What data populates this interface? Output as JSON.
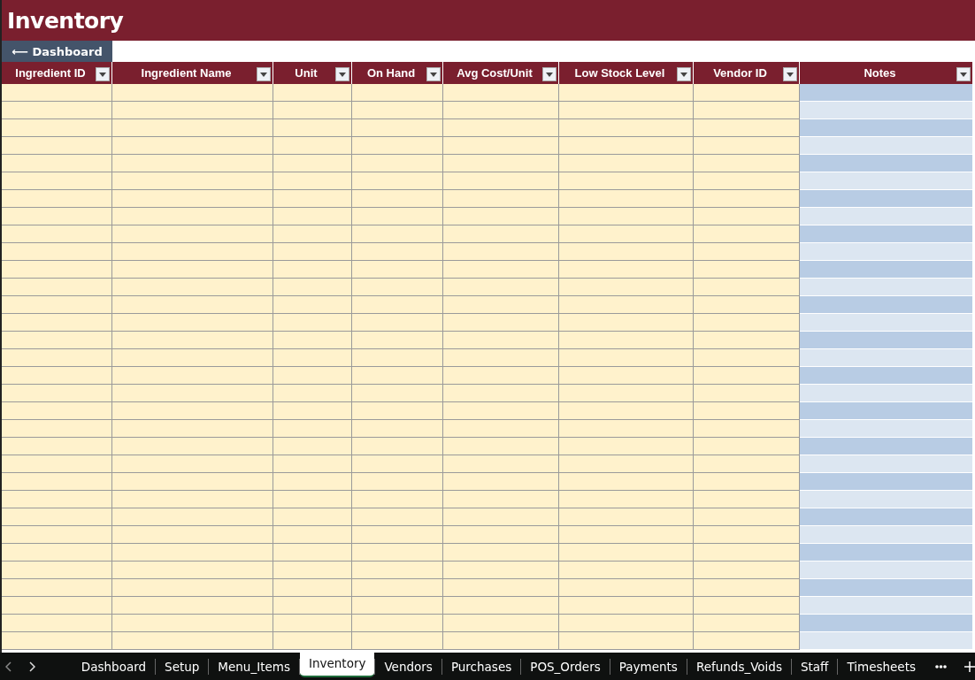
{
  "title": "Inventory",
  "back_button": {
    "label": "⟵ Dashboard"
  },
  "table": {
    "columns": [
      {
        "label": "Ingredient ID",
        "kind": "data"
      },
      {
        "label": "Ingredient Name",
        "kind": "data"
      },
      {
        "label": "Unit",
        "kind": "data"
      },
      {
        "label": "On Hand",
        "kind": "data"
      },
      {
        "label": "Avg Cost/Unit",
        "kind": "data"
      },
      {
        "label": "Low Stock Level",
        "kind": "data"
      },
      {
        "label": "Vendor ID",
        "kind": "data"
      },
      {
        "label": "Notes",
        "kind": "banded"
      }
    ]
  },
  "sheet_tabs": [
    {
      "label": "Dashboard",
      "selected": false
    },
    {
      "label": "Setup",
      "selected": false
    },
    {
      "label": "Menu_Items",
      "selected": false
    },
    {
      "label": "Inventory",
      "selected": true
    },
    {
      "label": "Vendors",
      "selected": false
    },
    {
      "label": "Purchases",
      "selected": false
    },
    {
      "label": "POS_Orders",
      "selected": false
    },
    {
      "label": "Payments",
      "selected": false
    },
    {
      "label": "Refunds_Voids",
      "selected": false
    },
    {
      "label": "Staff",
      "selected": false
    },
    {
      "label": "Timesheets",
      "selected": false
    }
  ]
}
